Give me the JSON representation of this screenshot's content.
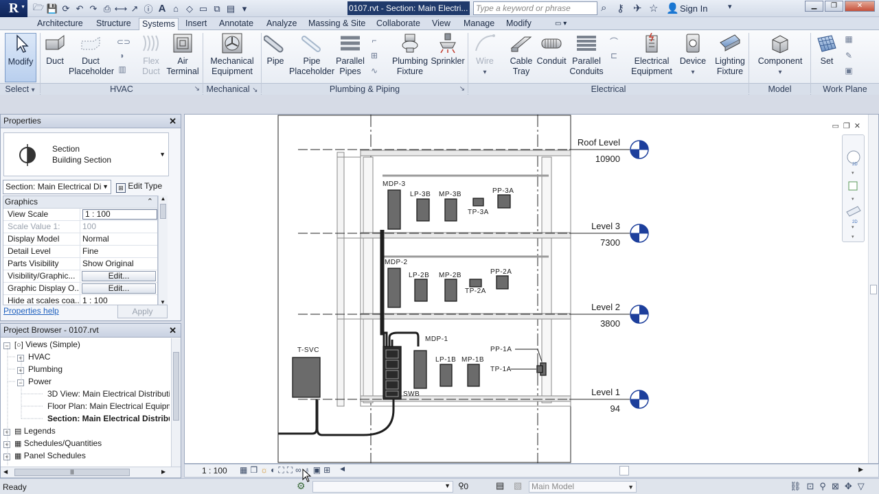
{
  "title_bar": {
    "document_title": "0107.rvt - Section: Main Electri...",
    "search_placeholder": "Type a keyword or phrase",
    "sign_in": "Sign In"
  },
  "tabs": [
    "Architecture",
    "Structure",
    "Systems",
    "Insert",
    "Annotate",
    "Analyze",
    "Massing & Site",
    "Collaborate",
    "View",
    "Manage",
    "Modify"
  ],
  "active_tab": "Systems",
  "ribbon": {
    "buttons": {
      "modify": "Modify",
      "duct": "Duct",
      "duct_placeholder_1": "Duct",
      "duct_placeholder_2": "Placeholder",
      "flex_duct_1": "Flex",
      "flex_duct_2": "Duct",
      "air_terminal_1": "Air",
      "air_terminal_2": "Terminal",
      "mech_eq_1": "Mechanical",
      "mech_eq_2": "Equipment",
      "pipe": "Pipe",
      "pipe_ph_1": "Pipe",
      "pipe_ph_2": "Placeholder",
      "par_pipes_1": "Parallel",
      "par_pipes_2": "Pipes",
      "plumb_fix_1": "Plumbing",
      "plumb_fix_2": "Fixture",
      "sprinkler": "Sprinkler",
      "wire": "Wire",
      "cable_tray_1": "Cable",
      "cable_tray_2": "Tray",
      "conduit": "Conduit",
      "par_conduits_1": "Parallel",
      "par_conduits_2": "Conduits",
      "elec_eq_1": "Electrical",
      "elec_eq_2": "Equipment",
      "device": "Device",
      "lighting_1": "Lighting",
      "lighting_2": "Fixture",
      "component": "Component",
      "set": "Set"
    },
    "panels": {
      "select": "Select",
      "hvac": "HVAC",
      "mechanical": "Mechanical",
      "plumbing": "Plumbing & Piping",
      "electrical": "Electrical",
      "model": "Model",
      "work_plane": "Work Plane"
    }
  },
  "properties": {
    "title": "Properties",
    "type_line1": "Section",
    "type_line2": "Building Section",
    "instance_selector": "Section: Main Electrical Di",
    "edit_type": "Edit Type",
    "group": "Graphics",
    "rows": [
      {
        "key": "View Scale",
        "value": "1 : 100"
      },
      {
        "key": "Scale Value   1:",
        "value": "100"
      },
      {
        "key": "Display Model",
        "value": "Normal"
      },
      {
        "key": "Detail Level",
        "value": "Fine"
      },
      {
        "key": "Parts Visibility",
        "value": "Show Original"
      },
      {
        "key": "Visibility/Graphic...",
        "value": "Edit..."
      },
      {
        "key": "Graphic Display O...",
        "value": "Edit..."
      },
      {
        "key": "Hide at scales coa...",
        "value": "1 : 100"
      }
    ],
    "help_link": "Properties help",
    "apply": "Apply"
  },
  "project_browser": {
    "title": "Project Browser - 0107.rvt",
    "nodes": {
      "views": "Views (Simple)",
      "hvac": "HVAC",
      "plumbing": "Plumbing",
      "power": "Power",
      "view_3d": "3D View: Main Electrical Distributi",
      "floor_plan": "Floor Plan: Main Electrical Equipm",
      "section": "Section: Main Electrical Distribut",
      "legends": "Legends",
      "schedules": "Schedules/Quantities",
      "panel_schedules": "Panel Schedules"
    }
  },
  "drawing": {
    "levels": [
      {
        "name": "Roof Level",
        "elevation": "10900"
      },
      {
        "name": "Level 3",
        "elevation": "7300"
      },
      {
        "name": "Level 2",
        "elevation": "3800"
      },
      {
        "name": "Level 1",
        "elevation": "94"
      }
    ],
    "tags": {
      "mdp3": "MDP-3",
      "lp3b": "LP-3B",
      "mp3b": "MP-3B",
      "pp3a": "PP-3A",
      "tp3a": "TP-3A",
      "mdp2": "MDP-2",
      "lp2b": "LP-2B",
      "mp2b": "MP-2B",
      "pp2a": "PP-2A",
      "tp2a": "TP-2A",
      "mdp1": "MDP-1",
      "lp1b": "LP-1B",
      "mp1b": "MP-1B",
      "pp1a": "PP-1A",
      "tp1a": "TP-1A",
      "tsvc": "T-SVC",
      "swb": "SWB"
    }
  },
  "view_bar": {
    "scale": "1 : 100"
  },
  "status_bar": {
    "status": "Ready",
    "zero": ":0",
    "model": "Main Model"
  },
  "colors": {
    "level_marker": "#1d3f9c",
    "equipment_fill": "#6b6b6b",
    "accent": "#203a6b"
  }
}
